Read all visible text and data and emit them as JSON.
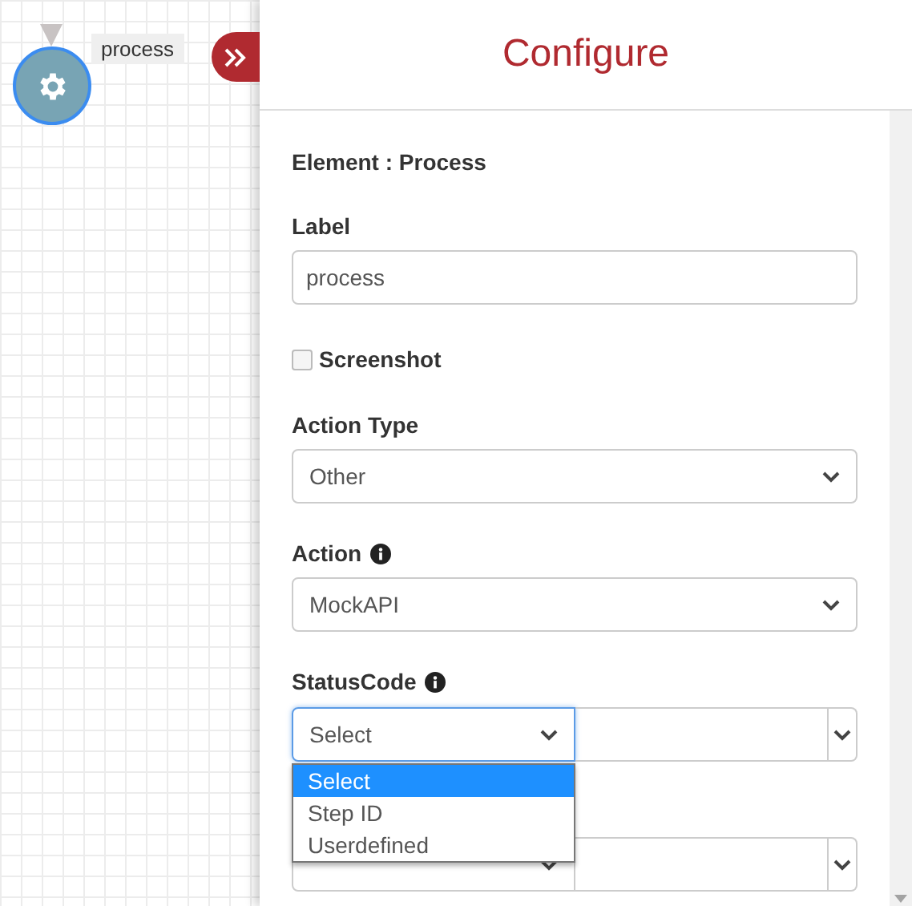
{
  "canvas": {
    "node_label": "process"
  },
  "panel": {
    "title": "Configure",
    "element_heading": "Element : Process",
    "fields": [
      {
        "kind": "text",
        "label": "Label",
        "value": "process"
      },
      {
        "kind": "checkbox",
        "label": "Screenshot",
        "checked": false
      },
      {
        "kind": "select",
        "label": "Action Type",
        "value": "Other",
        "info": false
      },
      {
        "kind": "select",
        "label": "Action",
        "value": "MockAPI",
        "info": true
      },
      {
        "kind": "pair",
        "label": "StatusCode",
        "info": true,
        "value": "Select",
        "expanded": true,
        "options": [
          {
            "label": "Select",
            "selected": true
          },
          {
            "label": "Step ID",
            "selected": false
          },
          {
            "label": "Userdefined",
            "selected": false
          }
        ]
      },
      {
        "kind": "pair",
        "expanded": false
      }
    ]
  }
}
